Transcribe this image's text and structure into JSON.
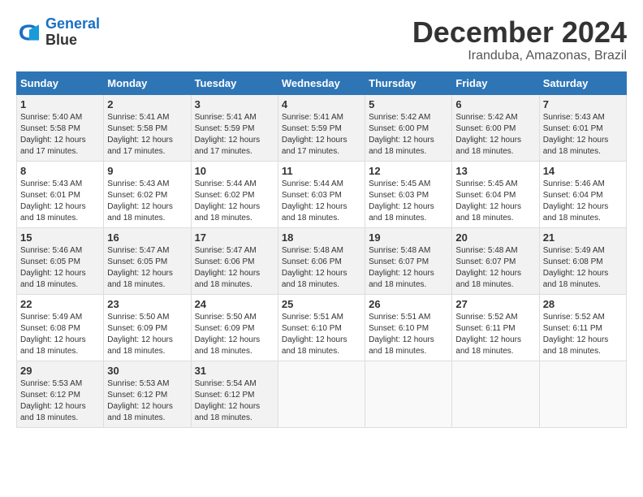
{
  "header": {
    "logo_line1": "General",
    "logo_line2": "Blue",
    "month": "December 2024",
    "location": "Iranduba, Amazonas, Brazil"
  },
  "days_of_week": [
    "Sunday",
    "Monday",
    "Tuesday",
    "Wednesday",
    "Thursday",
    "Friday",
    "Saturday"
  ],
  "weeks": [
    [
      {
        "num": "1",
        "rise": "5:40 AM",
        "set": "5:58 PM",
        "daylight": "12 hours and 17 minutes."
      },
      {
        "num": "2",
        "rise": "5:41 AM",
        "set": "5:58 PM",
        "daylight": "12 hours and 17 minutes."
      },
      {
        "num": "3",
        "rise": "5:41 AM",
        "set": "5:59 PM",
        "daylight": "12 hours and 17 minutes."
      },
      {
        "num": "4",
        "rise": "5:41 AM",
        "set": "5:59 PM",
        "daylight": "12 hours and 17 minutes."
      },
      {
        "num": "5",
        "rise": "5:42 AM",
        "set": "6:00 PM",
        "daylight": "12 hours and 18 minutes."
      },
      {
        "num": "6",
        "rise": "5:42 AM",
        "set": "6:00 PM",
        "daylight": "12 hours and 18 minutes."
      },
      {
        "num": "7",
        "rise": "5:43 AM",
        "set": "6:01 PM",
        "daylight": "12 hours and 18 minutes."
      }
    ],
    [
      {
        "num": "8",
        "rise": "5:43 AM",
        "set": "6:01 PM",
        "daylight": "12 hours and 18 minutes."
      },
      {
        "num": "9",
        "rise": "5:43 AM",
        "set": "6:02 PM",
        "daylight": "12 hours and 18 minutes."
      },
      {
        "num": "10",
        "rise": "5:44 AM",
        "set": "6:02 PM",
        "daylight": "12 hours and 18 minutes."
      },
      {
        "num": "11",
        "rise": "5:44 AM",
        "set": "6:03 PM",
        "daylight": "12 hours and 18 minutes."
      },
      {
        "num": "12",
        "rise": "5:45 AM",
        "set": "6:03 PM",
        "daylight": "12 hours and 18 minutes."
      },
      {
        "num": "13",
        "rise": "5:45 AM",
        "set": "6:04 PM",
        "daylight": "12 hours and 18 minutes."
      },
      {
        "num": "14",
        "rise": "5:46 AM",
        "set": "6:04 PM",
        "daylight": "12 hours and 18 minutes."
      }
    ],
    [
      {
        "num": "15",
        "rise": "5:46 AM",
        "set": "6:05 PM",
        "daylight": "12 hours and 18 minutes."
      },
      {
        "num": "16",
        "rise": "5:47 AM",
        "set": "6:05 PM",
        "daylight": "12 hours and 18 minutes."
      },
      {
        "num": "17",
        "rise": "5:47 AM",
        "set": "6:06 PM",
        "daylight": "12 hours and 18 minutes."
      },
      {
        "num": "18",
        "rise": "5:48 AM",
        "set": "6:06 PM",
        "daylight": "12 hours and 18 minutes."
      },
      {
        "num": "19",
        "rise": "5:48 AM",
        "set": "6:07 PM",
        "daylight": "12 hours and 18 minutes."
      },
      {
        "num": "20",
        "rise": "5:48 AM",
        "set": "6:07 PM",
        "daylight": "12 hours and 18 minutes."
      },
      {
        "num": "21",
        "rise": "5:49 AM",
        "set": "6:08 PM",
        "daylight": "12 hours and 18 minutes."
      }
    ],
    [
      {
        "num": "22",
        "rise": "5:49 AM",
        "set": "6:08 PM",
        "daylight": "12 hours and 18 minutes."
      },
      {
        "num": "23",
        "rise": "5:50 AM",
        "set": "6:09 PM",
        "daylight": "12 hours and 18 minutes."
      },
      {
        "num": "24",
        "rise": "5:50 AM",
        "set": "6:09 PM",
        "daylight": "12 hours and 18 minutes."
      },
      {
        "num": "25",
        "rise": "5:51 AM",
        "set": "6:10 PM",
        "daylight": "12 hours and 18 minutes."
      },
      {
        "num": "26",
        "rise": "5:51 AM",
        "set": "6:10 PM",
        "daylight": "12 hours and 18 minutes."
      },
      {
        "num": "27",
        "rise": "5:52 AM",
        "set": "6:11 PM",
        "daylight": "12 hours and 18 minutes."
      },
      {
        "num": "28",
        "rise": "5:52 AM",
        "set": "6:11 PM",
        "daylight": "12 hours and 18 minutes."
      }
    ],
    [
      {
        "num": "29",
        "rise": "5:53 AM",
        "set": "6:12 PM",
        "daylight": "12 hours and 18 minutes."
      },
      {
        "num": "30",
        "rise": "5:53 AM",
        "set": "6:12 PM",
        "daylight": "12 hours and 18 minutes."
      },
      {
        "num": "31",
        "rise": "5:54 AM",
        "set": "6:12 PM",
        "daylight": "12 hours and 18 minutes."
      },
      null,
      null,
      null,
      null
    ]
  ],
  "labels": {
    "sunrise": "Sunrise:",
    "sunset": "Sunset:",
    "daylight": "Daylight:"
  }
}
